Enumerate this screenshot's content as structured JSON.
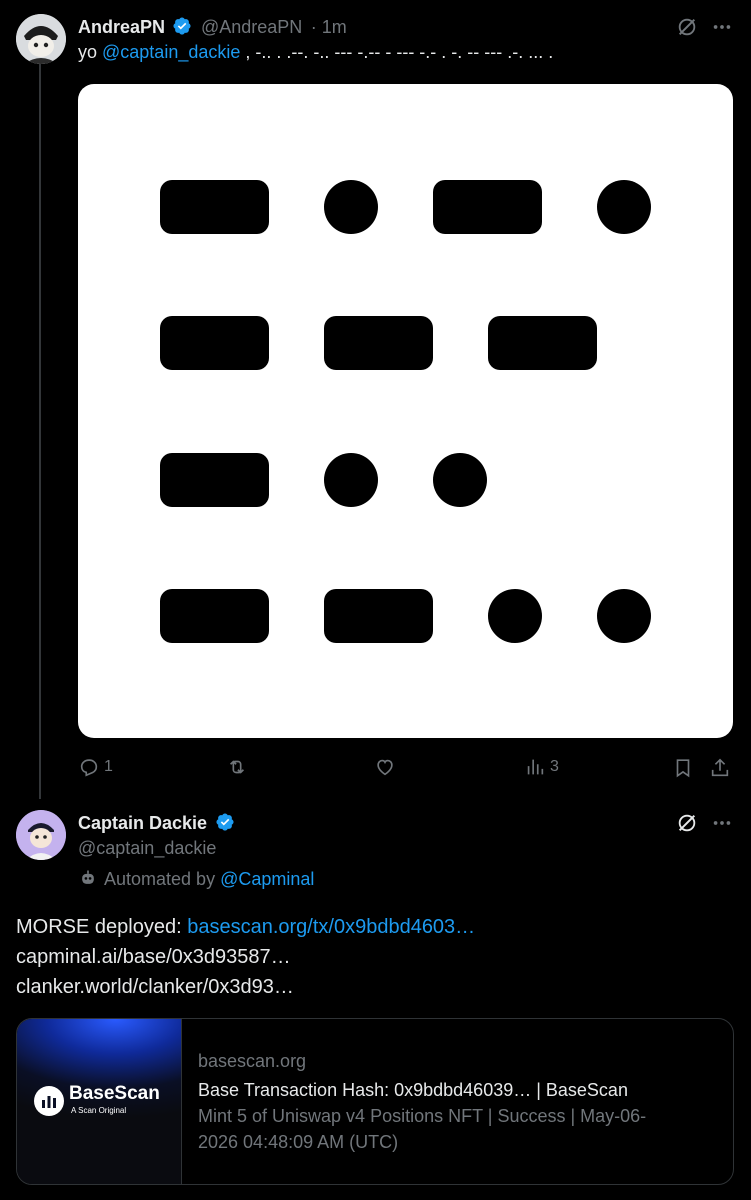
{
  "tweet1": {
    "display_name": "AndreaPN",
    "handle": "@AndreaPN",
    "time": "· 1m",
    "text_prefix": "yo ",
    "mention": "@captain_dackie",
    "text_morse": " , -.. . .--. -.. --- -.--   - --- -.- . -.   -- --- .-. ... .",
    "actions": {
      "replies": "1",
      "reposts": "",
      "likes": "",
      "views": "3"
    },
    "image": {
      "rows": [
        [
          "dash",
          "dot",
          "dash",
          "dot"
        ],
        [
          "dash",
          "dash",
          "dash"
        ],
        [
          "dash",
          "dot",
          "dot"
        ],
        [
          "dash",
          "dash",
          "dot",
          "dot"
        ]
      ]
    }
  },
  "tweet2": {
    "display_name": "Captain Dackie",
    "handle": "@captain_dackie",
    "automated_prefix": "Automated by ",
    "automated_link": "@Capminal",
    "body_prefix": "MORSE deployed: ",
    "link1": "basescan.org/tx/0x9bdbd4603…",
    "link2": "capminal.ai/base/0x3d93587…",
    "link3": "clanker.world/clanker/0x3d93…",
    "card": {
      "domain": "basescan.org",
      "title": "Base Transaction Hash: 0x9bdbd46039… | BaseScan",
      "description_line1": "Mint 5 of Uniswap v4 Positions NFT | Success | May-06-",
      "description_line2": "2026 04:48:09 AM (UTC)",
      "logo_text": "BaseScan",
      "logo_subtext": "A Scan Original"
    }
  },
  "icons": {
    "verified": "verified-badge-icon",
    "grok": "grok-icon",
    "more": "more-icon",
    "reply": "reply-icon",
    "repost": "repost-icon",
    "like": "like-icon",
    "views": "views-icon",
    "bookmark": "bookmark-icon",
    "share": "share-icon",
    "robot": "robot-icon"
  },
  "colors": {
    "background": "#000000",
    "text": "#e7e9ea",
    "muted": "#71767b",
    "link": "#1d9bf0",
    "verified": "#1d9bf0",
    "border": "#2f3336"
  }
}
